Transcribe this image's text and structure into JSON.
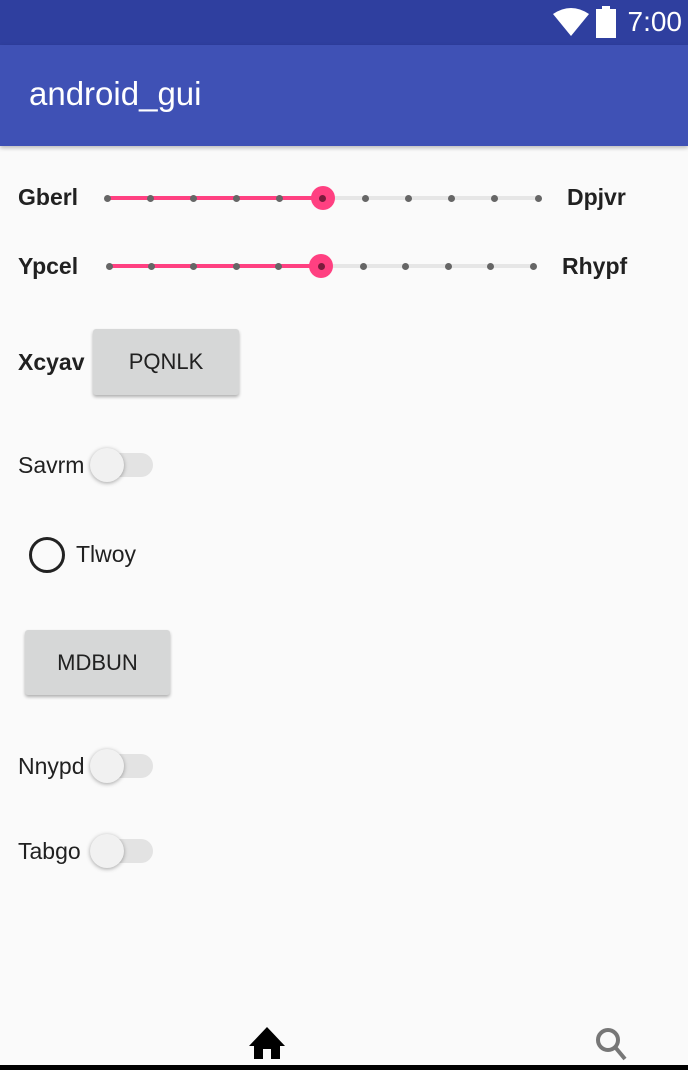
{
  "status_bar": {
    "time": "7:00",
    "icons": [
      "wifi-icon",
      "battery-icon"
    ]
  },
  "app_bar": {
    "title": "android_gui"
  },
  "sliders": [
    {
      "left_label": "Gberl",
      "right_label": "Dpjvr",
      "min": 0,
      "max": 10,
      "value": 5
    },
    {
      "left_label": "Ypcel",
      "right_label": "Rhypf",
      "min": 0,
      "max": 10,
      "value": 5
    }
  ],
  "row_button": {
    "label": "Xcyav",
    "button": "PQNLK"
  },
  "switch1": {
    "label": "Savrm",
    "checked": false
  },
  "radio": {
    "label": "Tlwoy",
    "checked": false
  },
  "button2": {
    "label": "MDBUN"
  },
  "switch2": {
    "label": "Nnypd",
    "checked": false
  },
  "switch3": {
    "label": "Tabgo",
    "checked": false
  },
  "bottom_nav": {
    "items": [
      "home-icon",
      "search-icon"
    ]
  },
  "colors": {
    "primary": "#3f51b5",
    "primary_dark": "#2f3f9f",
    "accent": "#ff4081"
  }
}
